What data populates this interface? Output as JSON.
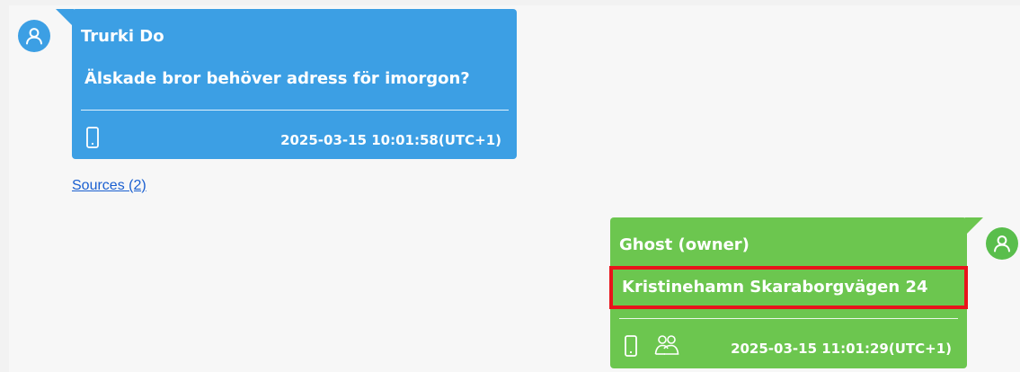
{
  "messages": [
    {
      "sender": "Trurki Do",
      "text": "Älskade bror behöver adress för imorgon?",
      "timestamp": "2025-03-15 10:01:58(UTC+1)",
      "source_icon": "phone-icon",
      "color": "#3c9fe4"
    },
    {
      "sender": "Ghost (owner)",
      "text": "Kristinehamn Skaraborgvägen 24",
      "timestamp": "2025-03-15 11:01:29(UTC+1)",
      "source_icon": "phone-icon",
      "group_icon": "group-icon",
      "color": "#6cc64f",
      "highlight_color": "#e8141b"
    }
  ],
  "sources_link": "Sources (2)"
}
